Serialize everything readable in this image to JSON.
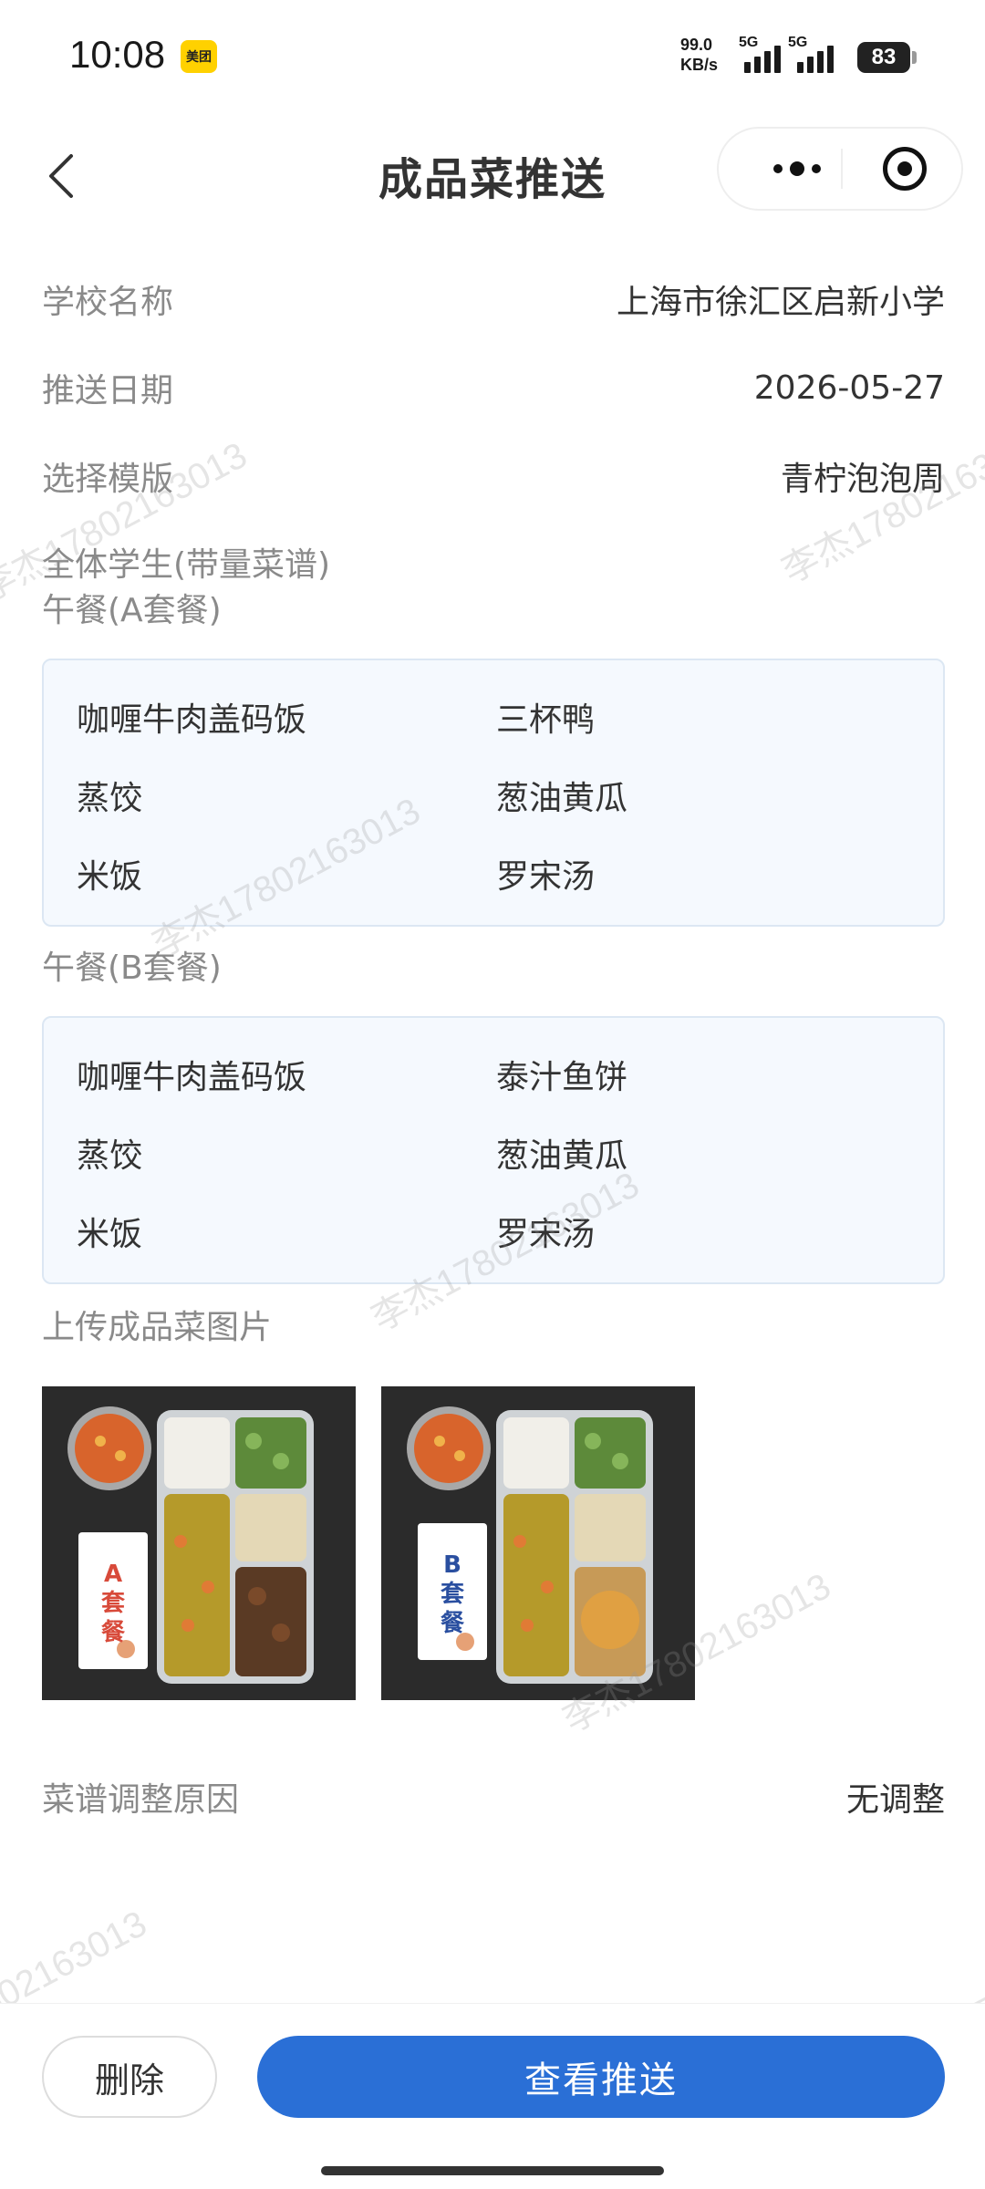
{
  "status_bar": {
    "time": "10:08",
    "app_badge": "美团",
    "net_speed_value": "99.0",
    "net_speed_unit": "KB/s",
    "signal1_label": "5G",
    "signal2_label": "5G",
    "battery": "83"
  },
  "nav": {
    "title": "成品菜推送"
  },
  "info": {
    "school_label": "学校名称",
    "school_value": "上海市徐汇区启新小学",
    "date_label": "推送日期",
    "date_value": "2026-05-27",
    "template_label": "选择模版",
    "template_value": "青柠泡泡周"
  },
  "menu_a": {
    "group_title": "全体学生(带量菜谱)",
    "title": "午餐(A套餐)",
    "items": [
      "咖喱牛肉盖码饭",
      "三杯鸭",
      "蒸饺",
      "葱油黄瓜",
      "米饭",
      "罗宋汤"
    ]
  },
  "menu_b": {
    "title": "午餐(B套餐)",
    "items": [
      "咖喱牛肉盖码饭",
      "泰汁鱼饼",
      "蒸饺",
      "葱油黄瓜",
      "米饭",
      "罗宋汤"
    ]
  },
  "photos": {
    "label": "上传成品菜图片",
    "card_a": "A套餐",
    "card_b": "B套餐"
  },
  "adjust": {
    "label": "菜谱调整原因",
    "value": "无调整"
  },
  "watermark": {
    "text": "李杰17802163013"
  },
  "actions": {
    "delete_label": "删除",
    "view_label": "查看推送"
  },
  "colors": {
    "primary": "#2a6fd6",
    "menu_bg": "#f5f9fe",
    "menu_border": "#dce7f3",
    "label_gray": "#8a8a8a"
  }
}
